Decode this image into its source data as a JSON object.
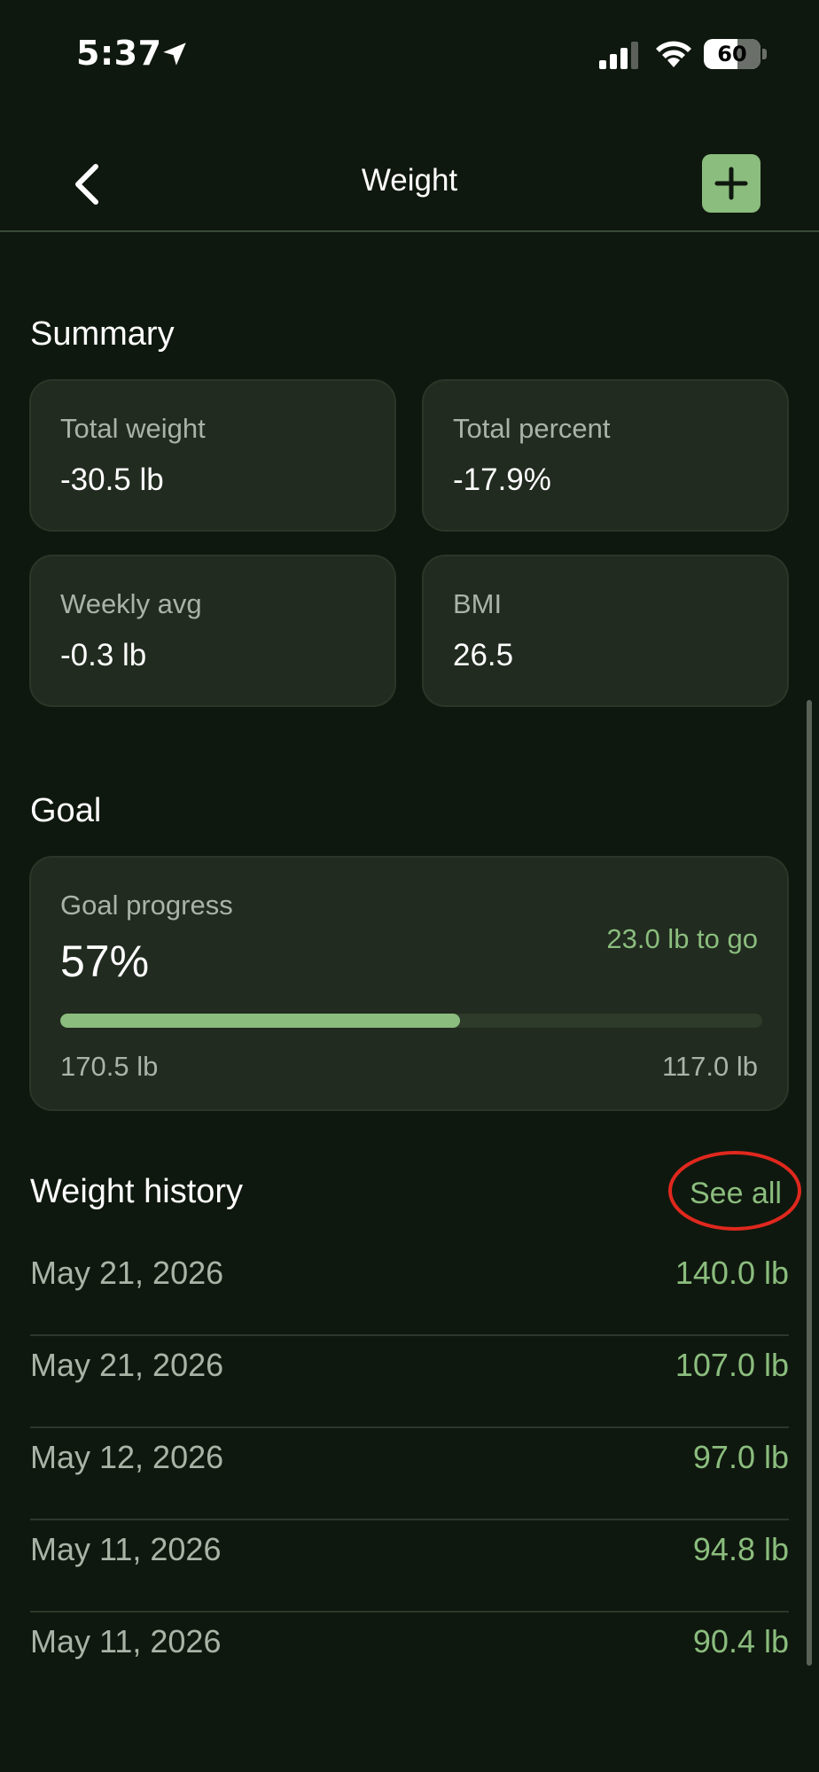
{
  "status_bar": {
    "time": "5:37",
    "battery": "60",
    "battery_level": 0.6
  },
  "nav": {
    "title": "Weight",
    "back_icon": "chevron-left-icon",
    "add_icon": "plus-icon"
  },
  "summary": {
    "title": "Summary",
    "cards": [
      {
        "label": "Total weight",
        "value": "-30.5 lb"
      },
      {
        "label": "Total percent",
        "value": "-17.9%"
      },
      {
        "label": "Weekly avg",
        "value": "-0.3 lb"
      },
      {
        "label": "BMI",
        "value": "26.5"
      }
    ]
  },
  "goal": {
    "title": "Goal",
    "label": "Goal progress",
    "percent": "57%",
    "progress": 0.57,
    "remaining": "23.0 lb to go",
    "start": "170.5 lb",
    "target": "117.0 lb"
  },
  "history": {
    "title": "Weight history",
    "see_all": "See all",
    "entries": [
      {
        "date": "May 21, 2026",
        "value": "140.0 lb"
      },
      {
        "date": "May 21, 2026",
        "value": "107.0 lb"
      },
      {
        "date": "May 12, 2026",
        "value": "97.0 lb"
      },
      {
        "date": "May 11, 2026",
        "value": "94.8 lb"
      },
      {
        "date": "May 11, 2026",
        "value": "90.4 lb"
      }
    ]
  },
  "colors": {
    "background": "#0f180e",
    "card": "#212b1f",
    "accent": "#8bbd7e",
    "annotation": "#e0281e"
  }
}
